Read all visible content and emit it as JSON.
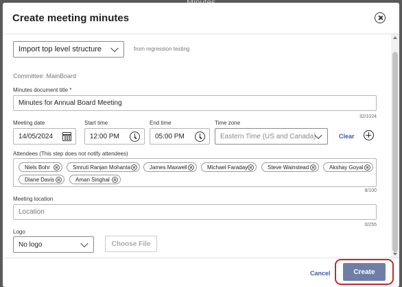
{
  "background": {
    "window_title": "Minutes"
  },
  "dialog": {
    "title": "Create meeting minutes",
    "structure_select": "Import top level structure",
    "structure_note": "from regression testing",
    "committee": "Committee: MainBoard",
    "title_field": {
      "label": "Minutes document title *",
      "value": "Minutes for Annual Board Meeting",
      "counter": "32/1024"
    },
    "meeting_date": {
      "label": "Meeting date",
      "value": "14/05/2024"
    },
    "start_time": {
      "label": "Start time",
      "value": "12:00 PM"
    },
    "end_time": {
      "label": "End time",
      "value": "05:00 PM"
    },
    "time_zone": {
      "label": "Time zone",
      "value": "Eastern Time (US and Canada)"
    },
    "clear_label": "Clear",
    "attendees": {
      "label": "Attendees (This step does not notify attendees)",
      "chips": [
        "Niels Bohr",
        "Smruti Ranjan Mohanta",
        "James Maxwell",
        "Michael Faraday",
        "Steve Wainstead",
        "Akshay Goyal",
        "Diane Davis",
        "Aman Singhal"
      ],
      "counter": "8/100"
    },
    "location": {
      "label": "Meeting location",
      "placeholder": "Location",
      "counter": "0/255"
    },
    "logo": {
      "label": "Logo",
      "value": "No logo",
      "choose_file": "Choose File"
    },
    "footer": {
      "cancel": "Cancel",
      "create": "Create"
    }
  },
  "colors": {
    "accent": "#3a5aa8",
    "create_button": "#6f7ea6",
    "highlight_ring": "#c2272d"
  },
  "icons": [
    "close-icon",
    "chevron-down-icon",
    "calendar-icon",
    "clock-icon",
    "add-circle-icon",
    "remove-chip-icon"
  ]
}
